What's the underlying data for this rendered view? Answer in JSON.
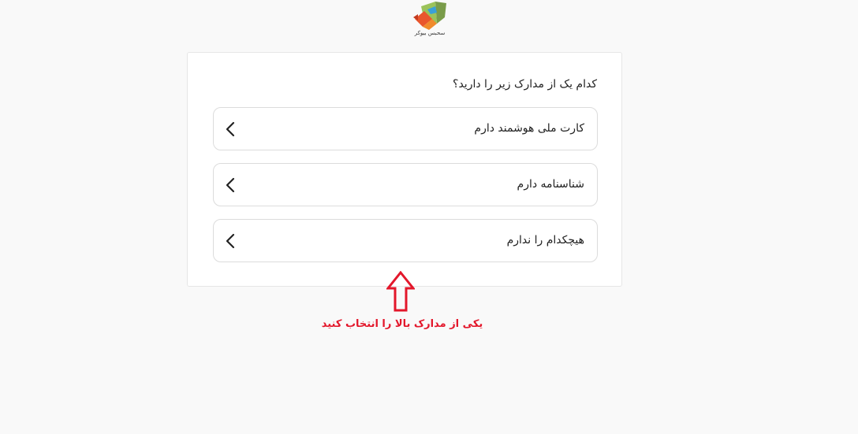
{
  "brand": {
    "logo_text": "سحبس بیوکر"
  },
  "question": {
    "title": "کدام یک از مدارک زیر را دارید؟"
  },
  "options": [
    {
      "label": "کارت ملی هوشمند دارم"
    },
    {
      "label": "شناسنامه دارم"
    },
    {
      "label": "هیچکدام را ندارم"
    }
  ],
  "annotation": {
    "hint": "یکی از مدارک بالا را انتخاب کنید",
    "color": "#e3172b",
    "arrow_icon": "arrow-up-outline-icon"
  },
  "icons": {
    "option_chevron": "chevron-left-icon"
  }
}
